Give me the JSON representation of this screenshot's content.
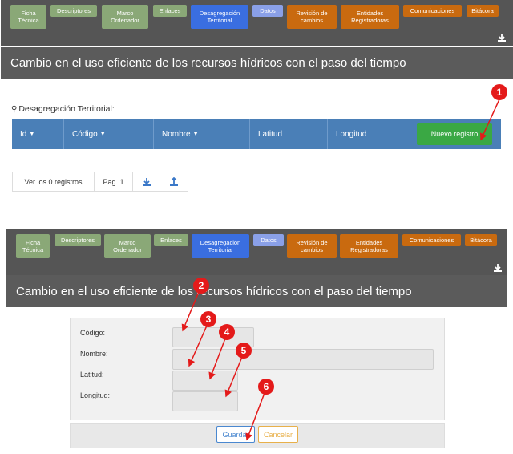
{
  "tabs": [
    {
      "label": "Ficha Técnica",
      "color": "green"
    },
    {
      "label": "Descriptores",
      "color": "green"
    },
    {
      "label": "Marco Ordenador",
      "color": "green"
    },
    {
      "label": "Enlaces",
      "color": "green"
    },
    {
      "label": "Desagregación Territorial",
      "color": "blue"
    },
    {
      "label": "Datos",
      "color": "lblue"
    },
    {
      "label": "Revisión de cambios",
      "color": "orange"
    },
    {
      "label": "Entidades Registradoras",
      "color": "orange"
    },
    {
      "label": "Comunicaciones",
      "color": "orange"
    },
    {
      "label": "Bitácora",
      "color": "orange"
    }
  ],
  "page_title": "Cambio en el uso eficiente de los recursos hídricos con el paso del tiempo",
  "section_label": "Desagregación Territorial:",
  "grid": {
    "columns": [
      "Id",
      "Código",
      "Nombre",
      "Latitud",
      "Longitud"
    ],
    "new_button": "Nuevo registro"
  },
  "pager": {
    "count_label": "Ver los 0 registros",
    "page_label": "Pag. 1"
  },
  "form": {
    "codigo_label": "Código:",
    "nombre_label": "Nombre:",
    "latitud_label": "Latitud:",
    "longitud_label": "Longitud:",
    "save_label": "Guardar",
    "cancel_label": "Cancelar"
  },
  "markers": [
    "1",
    "2",
    "3",
    "4",
    "5",
    "6"
  ],
  "colors": {
    "tab_green": "#8aa877",
    "tab_blue": "#3a6ee0",
    "tab_light_blue": "#8aa0e8",
    "tab_orange": "#c96a0f",
    "grid_header": "#4a7fb7",
    "new_button": "#3aa844",
    "marker": "#e41a1a"
  }
}
